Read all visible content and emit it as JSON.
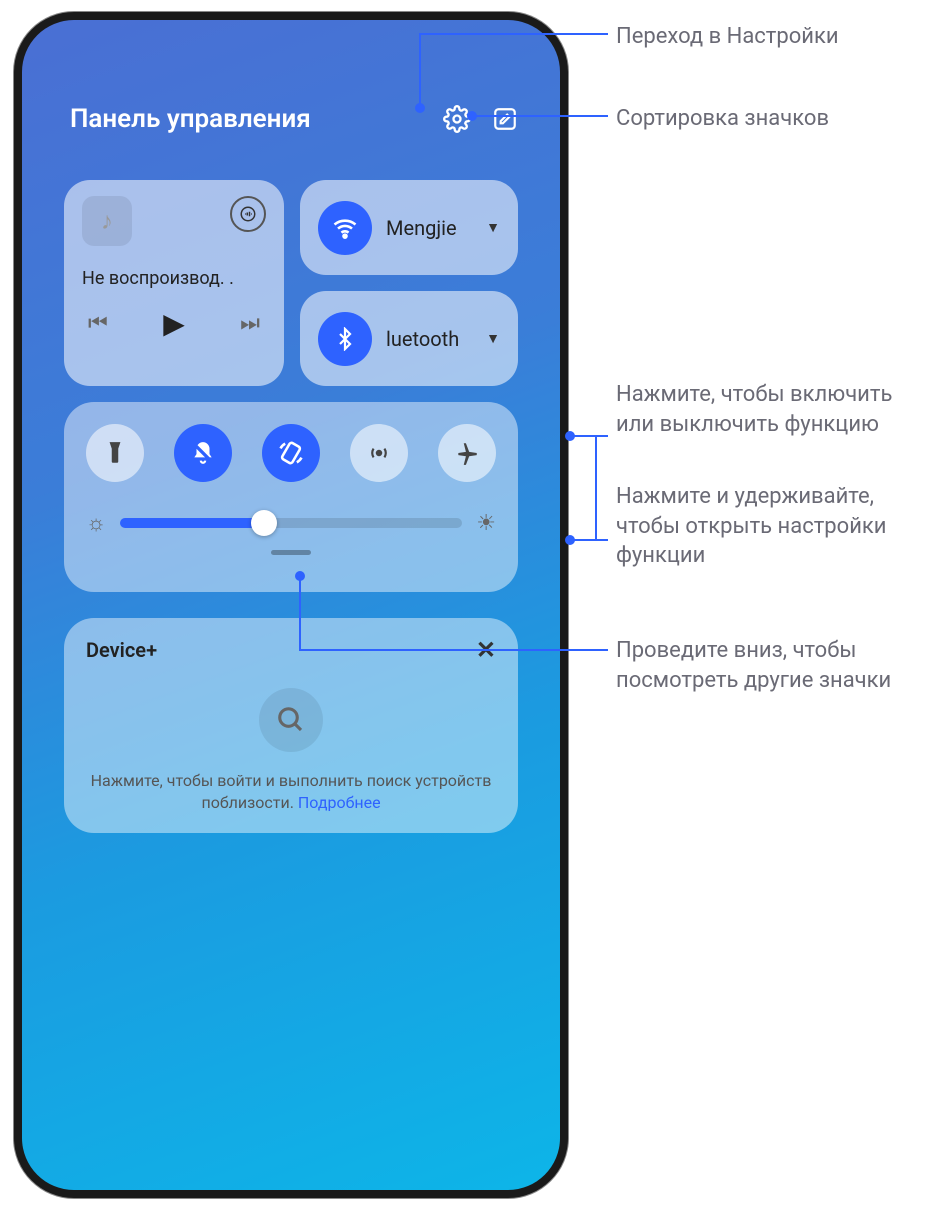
{
  "header": {
    "title": "Панель управления",
    "settings_icon": "gear",
    "edit_icon": "edit"
  },
  "music": {
    "status": "Не воспроизвод. .",
    "icons": {
      "note": "music-note",
      "cast": "cast",
      "prev": "prev",
      "play": "play",
      "next": "next"
    }
  },
  "wifi": {
    "label": "Mengjie",
    "on": true
  },
  "bluetooth": {
    "label": "luetooth",
    "on": true
  },
  "toggles": {
    "flashlight": {
      "on": false
    },
    "mute": {
      "on": true
    },
    "autorotate": {
      "on": true
    },
    "hotspot": {
      "on": false
    },
    "airplane": {
      "on": false
    }
  },
  "brightness": {
    "value": 42,
    "min": 0,
    "max": 100
  },
  "device_plus": {
    "title": "Device+",
    "hint_prefix": "Нажмите, чтобы войти и выполнить поиск устройств поблизости. ",
    "hint_link": "Подробнее"
  },
  "callouts": {
    "settings": "Переход в Настройки",
    "sort": "Сортировка значков",
    "tap": "Нажмите, чтобы включить или выключить функцию",
    "hold": "Нажмите и удерживайте, чтобы открыть настройки функции",
    "swipe": "Проведите вниз, чтобы посмотреть другие значки"
  },
  "colors": {
    "accent": "#2e62ff"
  }
}
